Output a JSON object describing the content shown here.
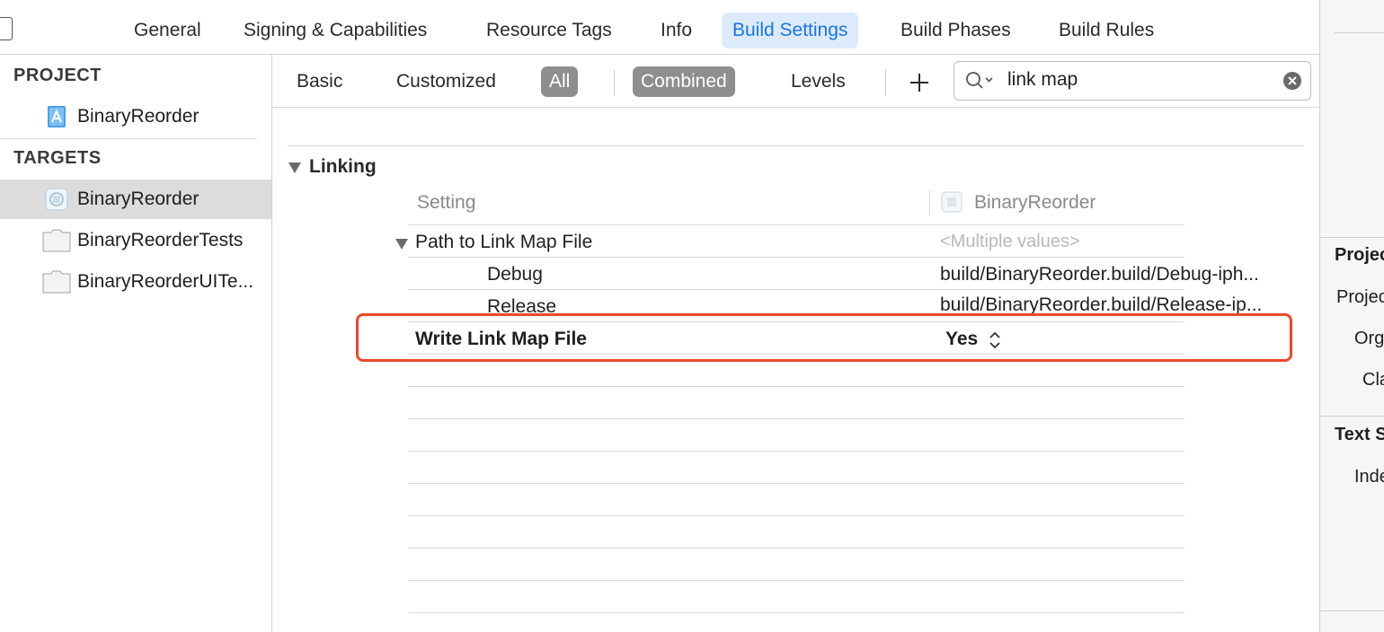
{
  "tabs": [
    {
      "label": "General",
      "active": false
    },
    {
      "label": "Signing & Capabilities",
      "active": false
    },
    {
      "label": "Resource Tags",
      "active": false
    },
    {
      "label": "Info",
      "active": false
    },
    {
      "label": "Build Settings",
      "active": true
    },
    {
      "label": "Build Phases",
      "active": false
    },
    {
      "label": "Build Rules",
      "active": false
    }
  ],
  "sidebar": {
    "project_header": "PROJECT",
    "project_item": "BinaryReorder",
    "targets_header": "TARGETS",
    "targets": [
      {
        "label": "BinaryReorder",
        "selected": true
      },
      {
        "label": "BinaryReorderTests",
        "selected": false
      },
      {
        "label": "BinaryReorderUITe...",
        "selected": false
      }
    ]
  },
  "filter": {
    "basic": "Basic",
    "customized": "Customized",
    "all": "All",
    "combined": "Combined",
    "levels": "Levels",
    "add_icon": "plus-icon",
    "search_value": "link map"
  },
  "settings": {
    "section_title": "Linking",
    "col_setting": "Setting",
    "col_target": "BinaryReorder",
    "rows": [
      {
        "name": "Path to Link Map File",
        "value": "<Multiple values>"
      },
      {
        "name": "Debug",
        "value": "build/BinaryReorder.build/Debug-iph..."
      },
      {
        "name": "Release",
        "value": "build/BinaryReorder.build/Release-ip..."
      },
      {
        "name": "Write Link Map File",
        "value": "Yes"
      }
    ]
  },
  "inspector": {
    "section1": "Projec",
    "line1": "Projec",
    "line2": "Org",
    "line3": "Cla",
    "section2": "Text S",
    "line4": "Inde"
  },
  "colors": {
    "accent": "#1a73e8",
    "tab_active_bg": "#dcebfb",
    "highlight": "#ea4a2a",
    "filter_on": "#8e8e8e"
  }
}
